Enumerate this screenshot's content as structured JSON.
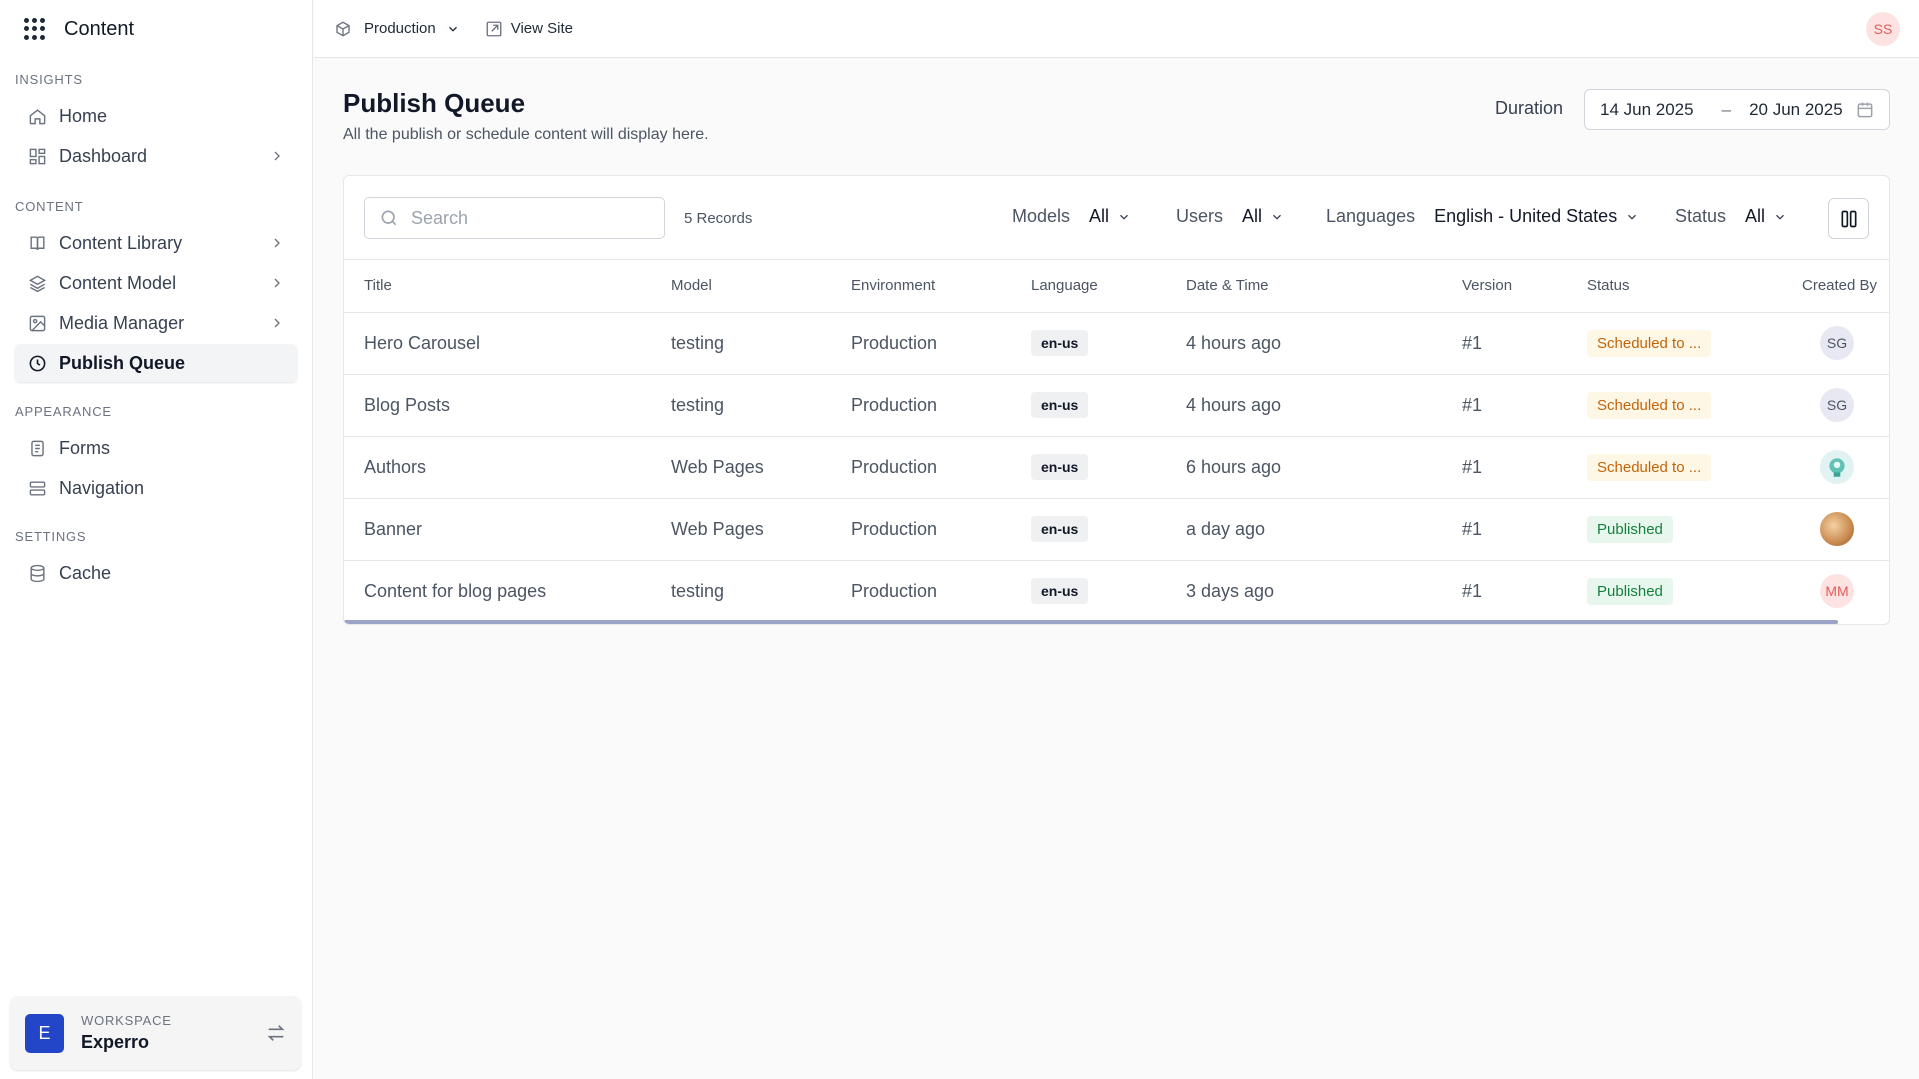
{
  "app": {
    "title": "Content"
  },
  "sidebar": {
    "sections": [
      {
        "label": "INSIGHTS",
        "items": [
          {
            "label": "Home",
            "icon": "home-icon"
          },
          {
            "label": "Dashboard",
            "icon": "dashboard-icon",
            "has_children": true
          }
        ]
      },
      {
        "label": "CONTENT",
        "items": [
          {
            "label": "Content Library",
            "icon": "book-icon",
            "has_children": true
          },
          {
            "label": "Content Model",
            "icon": "layers-icon",
            "has_children": true
          },
          {
            "label": "Media Manager",
            "icon": "image-icon",
            "has_children": true
          },
          {
            "label": "Publish Queue",
            "icon": "clock-icon",
            "active": true
          }
        ]
      },
      {
        "label": "APPEARANCE",
        "items": [
          {
            "label": "Forms",
            "icon": "form-icon"
          },
          {
            "label": "Navigation",
            "icon": "navigation-icon"
          }
        ]
      },
      {
        "label": "SETTINGS",
        "items": [
          {
            "label": "Cache",
            "icon": "database-icon"
          }
        ]
      }
    ],
    "workspace": {
      "label": "WORKSPACE",
      "name": "Experro",
      "initial": "E"
    }
  },
  "topbar": {
    "environment": "Production",
    "view_site": "View Site",
    "user_initials": "SS"
  },
  "header": {
    "title": "Publish Queue",
    "subtitle": "All the publish or schedule content will display here.",
    "duration_label": "Duration",
    "date_from": "14 Jun 2025",
    "date_sep": "–",
    "date_to": "20 Jun 2025"
  },
  "toolbar": {
    "search_placeholder": "Search",
    "records": "5 Records",
    "filters": {
      "models": {
        "label": "Models",
        "value": "All"
      },
      "users": {
        "label": "Users",
        "value": "All"
      },
      "languages": {
        "label": "Languages",
        "value": "English - United States"
      },
      "status": {
        "label": "Status",
        "value": "All"
      }
    }
  },
  "table": {
    "columns": [
      "Title",
      "Model",
      "Environment",
      "Language",
      "Date & Time",
      "Version",
      "Status",
      "Created By"
    ],
    "rows": [
      {
        "title": "Hero Carousel",
        "model": "testing",
        "environment": "Production",
        "language": "en-us",
        "datetime": "4 hours ago",
        "version": "#1",
        "status": "Scheduled to ...",
        "status_type": "scheduled",
        "created_by": "SG",
        "avatar_type": "sg"
      },
      {
        "title": "Blog Posts",
        "model": "testing",
        "environment": "Production",
        "language": "en-us",
        "datetime": "4 hours ago",
        "version": "#1",
        "status": "Scheduled to ...",
        "status_type": "scheduled",
        "created_by": "SG",
        "avatar_type": "sg"
      },
      {
        "title": "Authors",
        "model": "Web Pages",
        "environment": "Production",
        "language": "en-us",
        "datetime": "6 hours ago",
        "version": "#1",
        "status": "Scheduled to ...",
        "status_type": "scheduled",
        "created_by": "",
        "avatar_type": "teal"
      },
      {
        "title": "Banner",
        "model": "Web Pages",
        "environment": "Production",
        "language": "en-us",
        "datetime": "a day ago",
        "version": "#1",
        "status": "Published",
        "status_type": "published",
        "created_by": "",
        "avatar_type": "photo"
      },
      {
        "title": "Content for blog pages",
        "model": "testing",
        "environment": "Production",
        "language": "en-us",
        "datetime": "3 days ago",
        "version": "#1",
        "status": "Published",
        "status_type": "published",
        "created_by": "MM",
        "avatar_type": "mm"
      }
    ]
  },
  "colors": {
    "accent": "#2346c9",
    "scheduled": "#c2650a",
    "published": "#15803d",
    "user_avatar": "#e45b5b"
  }
}
